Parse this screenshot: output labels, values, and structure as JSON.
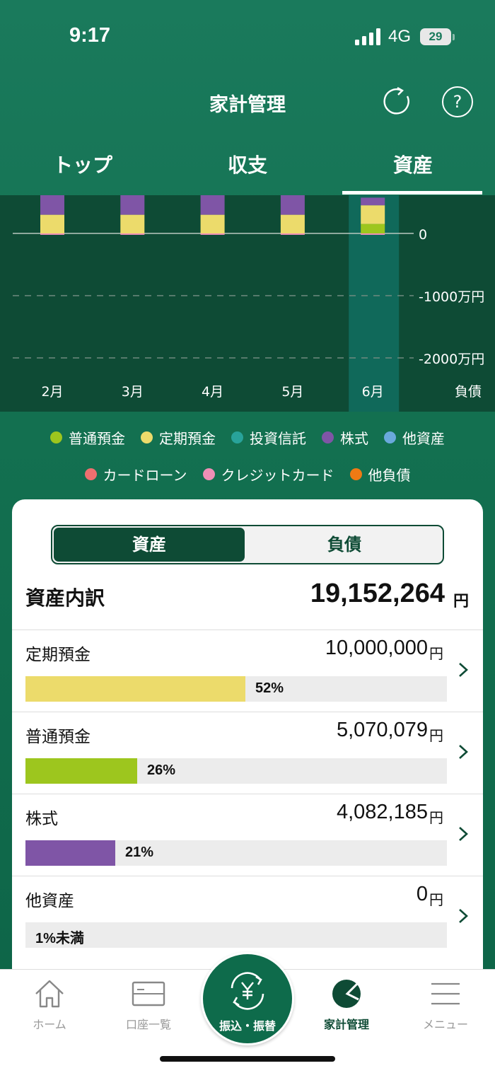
{
  "status_bar": {
    "time": "9:17",
    "network": "4G",
    "battery": "29"
  },
  "header": {
    "title": "家計管理",
    "refresh_icon": "refresh-icon",
    "help_icon": "help-icon",
    "help_glyph": "?"
  },
  "tabs": [
    {
      "label": "トップ",
      "active": false
    },
    {
      "label": "収支",
      "active": false
    },
    {
      "label": "資産",
      "active": true
    }
  ],
  "chart_data": {
    "type": "bar",
    "stacked": true,
    "categories": [
      "2月",
      "3月",
      "4月",
      "5月",
      "6月"
    ],
    "y_tick_labels": [
      "0",
      "-1000万円",
      "-2000万円"
    ],
    "y_ticks": [
      0,
      -1000,
      -2000
    ],
    "liability_label": "負債",
    "selected_category": "6月",
    "series": [
      {
        "name": "普通預金",
        "color": "#9dc61e",
        "values": [
          0,
          0,
          0,
          0,
          507
        ]
      },
      {
        "name": "定期預金",
        "color": "#ecdb6b",
        "values": [
          1000,
          1000,
          1000,
          1000,
          1000
        ]
      },
      {
        "name": "株式",
        "color": "#7f55a6",
        "values": [
          1100,
          1100,
          1100,
          1100,
          408
        ]
      },
      {
        "name": "クレジットカード",
        "color": "#ef8fb6",
        "values": [
          -60,
          -60,
          -40,
          -40,
          -40
        ]
      }
    ]
  },
  "legend": [
    {
      "label": "普通預金",
      "color": "#9dc61e"
    },
    {
      "label": "定期預金",
      "color": "#ecdb6b"
    },
    {
      "label": "投資信託",
      "color": "#28a39a"
    },
    {
      "label": "株式",
      "color": "#7f55a6"
    },
    {
      "label": "他資産",
      "color": "#6aa9dc"
    },
    {
      "label": "カードローン",
      "color": "#ee6f6f"
    },
    {
      "label": "クレジットカード",
      "color": "#ef8fb6"
    },
    {
      "label": "他負債",
      "color": "#ef7a14"
    }
  ],
  "segment": {
    "assets": "資産",
    "liabilities": "負債"
  },
  "breakdown": {
    "title": "資産内訳",
    "total": "19,152,264",
    "unit": "円",
    "rows": [
      {
        "name": "定期預金",
        "amount": "10,000,000",
        "unit": "円",
        "percent_label": "52%",
        "share": 52.2,
        "color": "#ecdb6b"
      },
      {
        "name": "普通預金",
        "amount": "5,070,079",
        "unit": "円",
        "percent_label": "26%",
        "share": 26.5,
        "color": "#9dc61e"
      },
      {
        "name": "株式",
        "amount": "4,082,185",
        "unit": "円",
        "percent_label": "21%",
        "share": 21.3,
        "color": "#7f55a6"
      },
      {
        "name": "他資産",
        "amount": "0",
        "unit": "円",
        "percent_label": "1%未満",
        "share": 0,
        "color": "#6aa9dc"
      }
    ]
  },
  "bottom_nav": {
    "home": "ホーム",
    "accounts": "口座一覧",
    "transfer": "振込・振替",
    "budget": "家計管理",
    "menu": "メニュー"
  }
}
